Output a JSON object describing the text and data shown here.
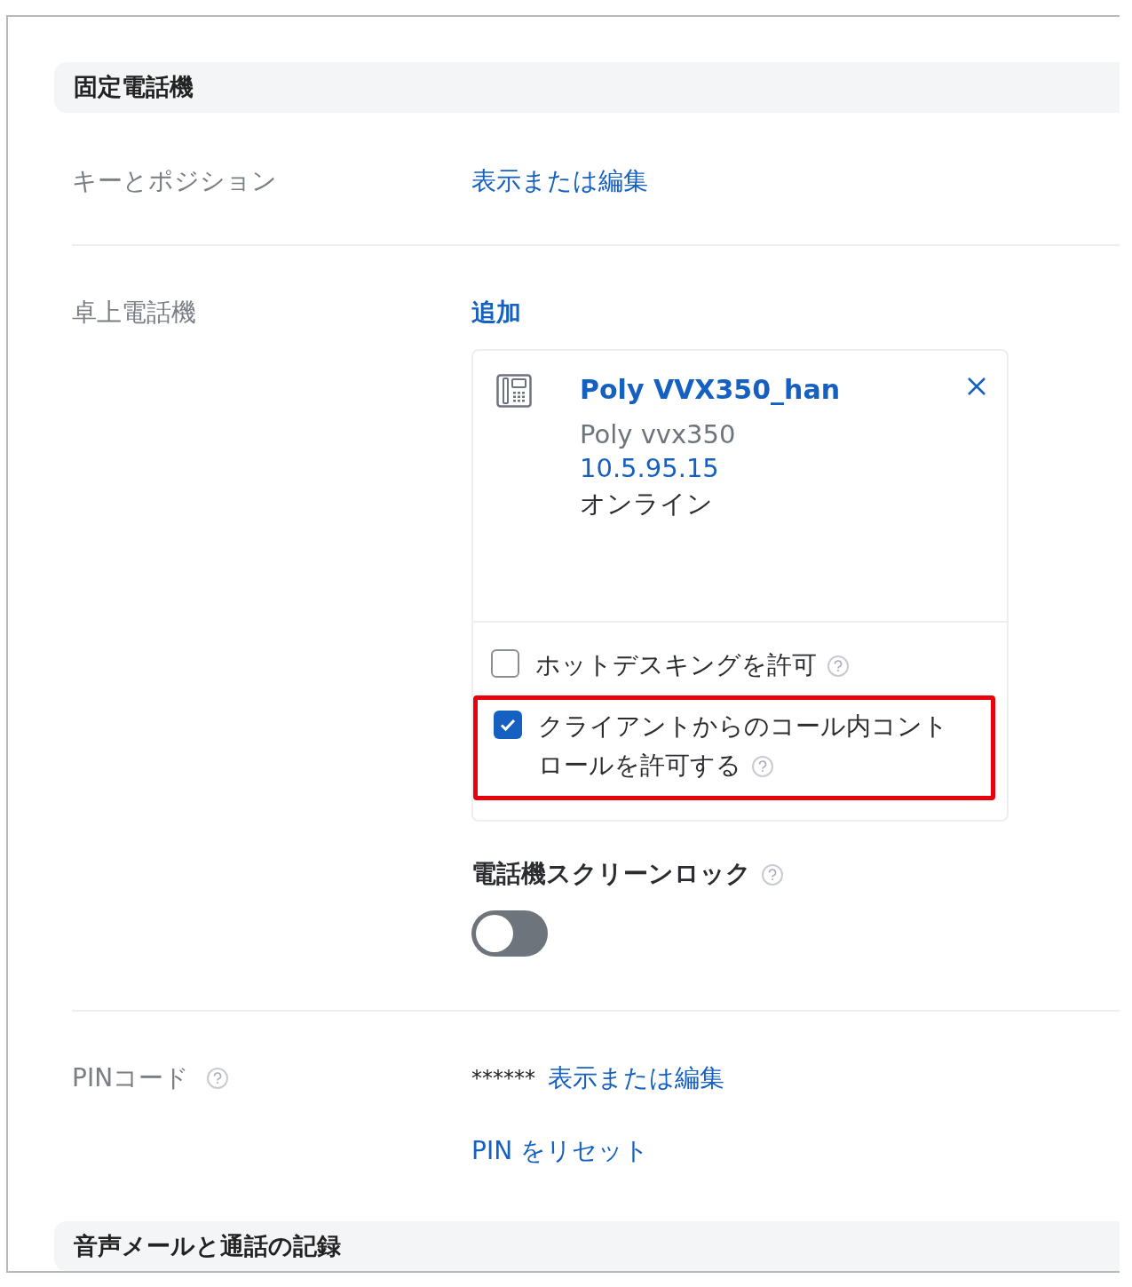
{
  "sections": [
    {
      "title": "固定電話機"
    },
    {
      "title": "音声メールと通話の記録"
    }
  ],
  "keys_row": {
    "label": "キーとポジション",
    "link": "表示または編集"
  },
  "desk_phone_row": {
    "label": "卓上電話機",
    "add_link": "追加",
    "device": {
      "name": "Poly VVX350_han",
      "model": "Poly vvx350",
      "ip": "10.5.95.15",
      "status": "オンライン",
      "options": [
        {
          "label": "ホットデスキングを許可",
          "checked": false,
          "highlighted": false
        },
        {
          "label": "クライアントからのコール内コントロールを許可する",
          "checked": true,
          "highlighted": true
        }
      ]
    },
    "screen_lock": {
      "label": "電話機スクリーンロック",
      "on": false
    }
  },
  "pin_row": {
    "label": "PINコード",
    "masked": "******",
    "link": "表示または編集",
    "reset_link": "PIN をリセット"
  }
}
